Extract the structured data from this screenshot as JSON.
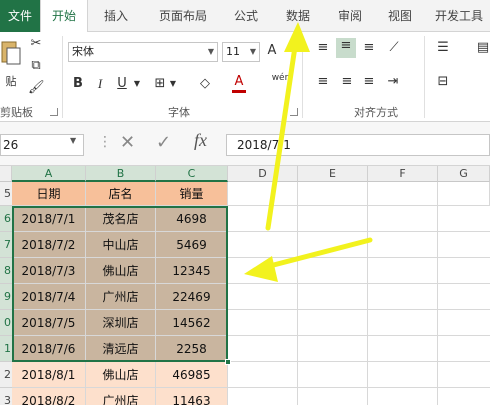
{
  "tabs": [
    "文件",
    "开始",
    "插入",
    "页面布局",
    "公式",
    "数据",
    "审阅",
    "视图",
    "开发工具"
  ],
  "ribbon": {
    "paste_label": "贴",
    "clipboard_label": "剪贴板",
    "font_name": "宋体",
    "font_size": "11",
    "font_group_label": "字体",
    "align_group_label": "对齐方式",
    "bold": "B",
    "italic": "I",
    "underline": "U",
    "grow_font": "A",
    "font_color_letter": "A",
    "wen": "wén"
  },
  "formula_bar": {
    "name_box": "26",
    "fx": "fx",
    "content": "2018/7/1"
  },
  "columns": [
    "A",
    "B",
    "C",
    "D",
    "E",
    "F",
    "G"
  ],
  "row_numbers": [
    "5",
    "6",
    "7",
    "8",
    "9",
    "0",
    "1",
    "2",
    "3"
  ],
  "table": {
    "headers": [
      "日期",
      "店名",
      "销量"
    ],
    "rows": [
      [
        "2018/7/1",
        "茂名店",
        "4698"
      ],
      [
        "2018/7/2",
        "中山店",
        "5469"
      ],
      [
        "2018/7/3",
        "佛山店",
        "12345"
      ],
      [
        "2018/7/4",
        "广州店",
        "22469"
      ],
      [
        "2018/7/5",
        "深圳店",
        "14562"
      ],
      [
        "2018/7/6",
        "清远店",
        "2258"
      ],
      [
        "2018/8/1",
        "佛山店",
        "46985"
      ],
      [
        "2018/8/2",
        "广州店",
        "11463"
      ]
    ]
  },
  "colors": {
    "accent": "#217346",
    "header_fill": "#f7c09a",
    "selected_fill": "#c9b59f",
    "data_fill": "#fde0cc",
    "arrow": "#f2f21e"
  }
}
